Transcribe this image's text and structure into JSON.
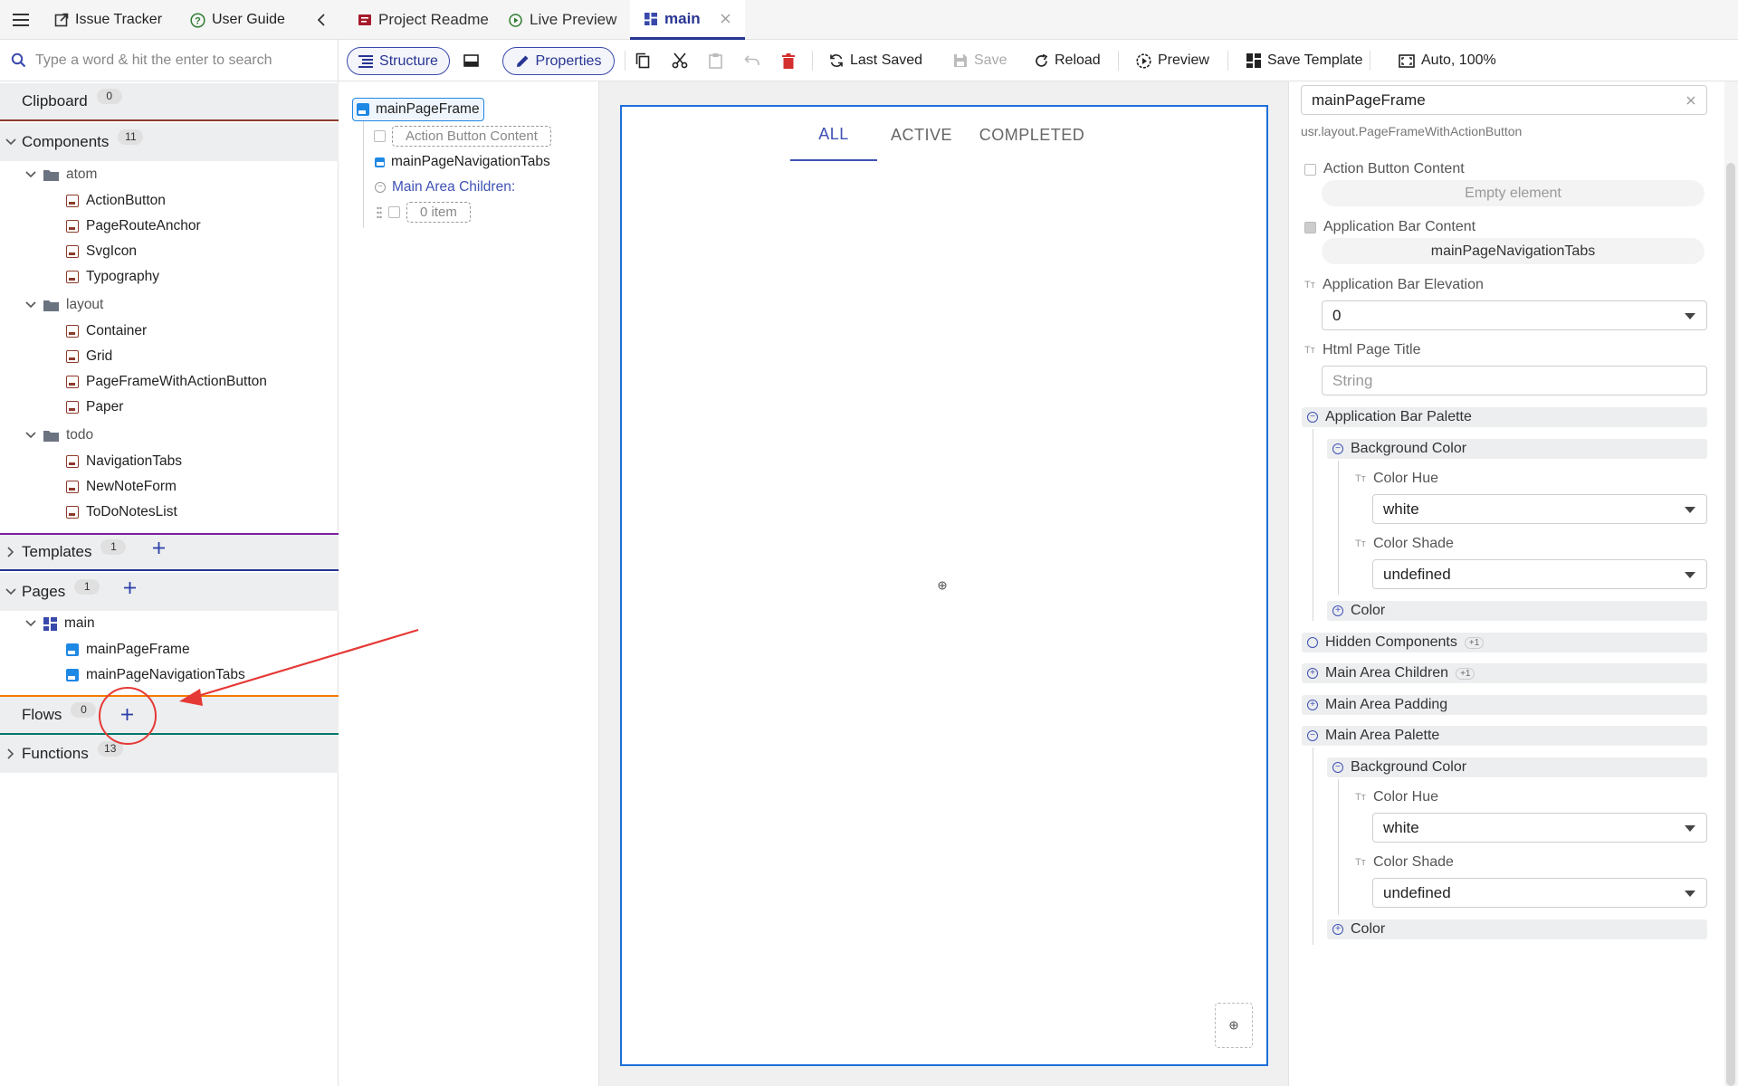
{
  "left_topbar": {
    "issue_tracker": "Issue Tracker",
    "user_guide": "User Guide"
  },
  "search": {
    "placeholder": "Type a word & hit the enter to search"
  },
  "sections": {
    "clipboard": {
      "label": "Clipboard",
      "count": "0"
    },
    "components": {
      "label": "Components",
      "count": "11"
    },
    "templates": {
      "label": "Templates",
      "count": "1"
    },
    "pages": {
      "label": "Pages",
      "count": "1"
    },
    "flows": {
      "label": "Flows",
      "count": "0"
    },
    "functions": {
      "label": "Functions",
      "count": "13"
    }
  },
  "components_tree": {
    "atom": {
      "label": "atom",
      "items": [
        "ActionButton",
        "PageRouteAnchor",
        "SvgIcon",
        "Typography"
      ]
    },
    "layout": {
      "label": "layout",
      "items": [
        "Container",
        "Grid",
        "PageFrameWithActionButton",
        "Paper"
      ]
    },
    "todo": {
      "label": "todo",
      "items": [
        "NavigationTabs",
        "NewNoteForm",
        "ToDoNotesList"
      ]
    }
  },
  "pages_tree": {
    "main": {
      "label": "main",
      "items": [
        "mainPageFrame",
        "mainPageNavigationTabs"
      ]
    }
  },
  "tabs": {
    "project_readme": "Project Readme",
    "live_preview": "Live Preview",
    "main": "main"
  },
  "toolbar": {
    "structure": "Structure",
    "properties": "Properties",
    "last_saved": "Last Saved",
    "save": "Save",
    "reload": "Reload",
    "preview": "Preview",
    "save_template": "Save Template",
    "zoom": "Auto, 100%"
  },
  "structure_tree": {
    "root": "mainPageFrame",
    "action_button_content": "Action Button Content",
    "navigation_tabs": "mainPageNavigationTabs",
    "main_area_children": "Main Area Children:",
    "item_count": "0 item"
  },
  "canvas": {
    "nav_tabs": [
      "ALL",
      "ACTIVE",
      "COMPLETED"
    ],
    "active_tab": "ALL"
  },
  "properties": {
    "instance_name": "mainPageFrame",
    "component_path": "usr.layout.PageFrameWithActionButton",
    "action_button_content": {
      "label": "Action Button Content",
      "value": "Empty element"
    },
    "app_bar_content": {
      "label": "Application Bar Content",
      "value": "mainPageNavigationTabs"
    },
    "app_bar_elevation": {
      "label": "Application Bar Elevation",
      "value": "0"
    },
    "html_page_title": {
      "label": "Html Page Title",
      "placeholder": "String"
    },
    "app_bar_palette": {
      "label": "Application Bar Palette",
      "background_color": "Background Color",
      "color_hue": {
        "label": "Color Hue",
        "value": "white"
      },
      "color_shade": {
        "label": "Color Shade",
        "value": "undefined"
      },
      "color": "Color"
    },
    "hidden_components": {
      "label": "Hidden Components",
      "badge": "+1"
    },
    "main_area_children": {
      "label": "Main Area Children",
      "badge": "+1"
    },
    "main_area_padding": {
      "label": "Main Area Padding"
    },
    "main_area_palette": {
      "label": "Main Area Palette",
      "background_color": "Background Color",
      "color_hue": {
        "label": "Color Hue",
        "value": "white"
      },
      "color_shade": {
        "label": "Color Shade",
        "value": "undefined"
      },
      "color": "Color"
    }
  },
  "colors": {
    "accent": "#283593",
    "canvas_border": "#1e6fd9",
    "delete": "#d32f2f",
    "annotation": "#e53935",
    "clipboard_divider": "#8d3b2e",
    "templates_divider": "#7b1fa2",
    "pages_divider": "#283593",
    "flows_divider": "#f57c00",
    "functions_divider": "#00796b"
  }
}
